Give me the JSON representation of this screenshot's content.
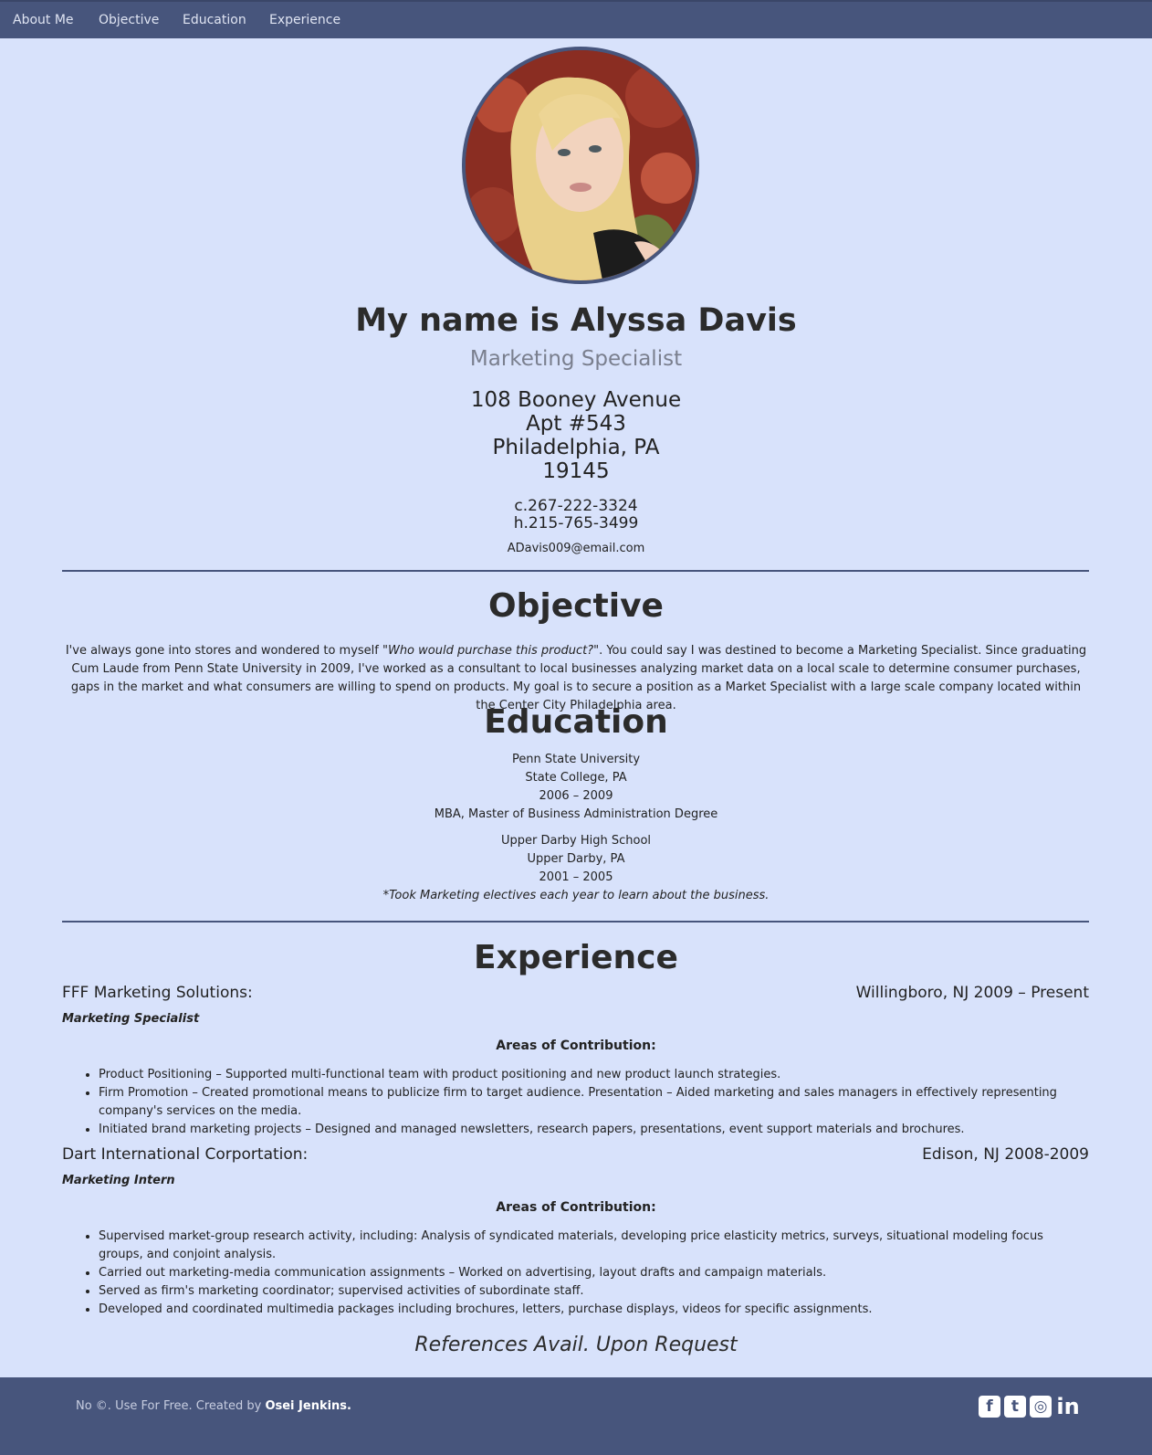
{
  "nav": {
    "items": [
      "About Me",
      "Objective",
      "Education",
      "Experience"
    ]
  },
  "header": {
    "name": "My name is Alyssa Davis",
    "title": "Marketing Specialist",
    "address": [
      "108 Booney Avenue",
      "Apt #543",
      "Philadelphia, PA",
      "19145"
    ],
    "phones": [
      "c.267-222-3324",
      "h.215-765-3499"
    ],
    "email": "ADavis009@email.com"
  },
  "objective": {
    "heading": "Objective",
    "text_before": "I've always gone into stores and wondered to myself ",
    "quote": "\"Who would purchase this product?\"",
    "text_after": ". You could say I was destined to become a Marketing Specialist. Since graduating Cum Laude from Penn State University in 2009, I've worked as a consultant to local businesses analyzing market data on a local scale to determine consumer purchases, gaps in the market and what consumers are willing to spend on products. My goal is to secure a position as a Market Specialist with a large scale company located within the Center City Philadelphia area."
  },
  "education": {
    "heading": "Education",
    "school1": [
      "Penn State University",
      "State College, PA",
      "2006 – 2009",
      "MBA, Master of Business Administration Degree"
    ],
    "school2": [
      "Upper Darby High School",
      "Upper Darby, PA",
      "2001 – 2005"
    ],
    "school2_note": "*Took Marketing electives each year to learn about the business."
  },
  "experience": {
    "heading": "Experience",
    "areas_label": "Areas of Contribution:",
    "jobs": [
      {
        "company": "FFF Marketing Solutions:",
        "location": "Willingboro, NJ 2009 – Present",
        "role": "Marketing Specialist",
        "bullets": [
          "Product Positioning – Supported multi-functional team with product positioning and new product launch strategies.",
          "Firm Promotion – Created promotional means to publicize firm to target audience. Presentation – Aided marketing and sales managers in effectively representing company's services on the media.",
          "Initiated brand marketing projects – Designed and managed newsletters, research papers, presentations, event support materials and brochures."
        ]
      },
      {
        "company": "Dart International Corportation:",
        "location": "Edison, NJ 2008-2009",
        "role": "Marketing Intern",
        "bullets": [
          "Supervised market-group research activity, including: Analysis of syndicated materials, developing price elasticity metrics, surveys, situational modeling focus groups, and conjoint analysis.",
          "Carried out marketing-media communication assignments – Worked on advertising, layout drafts and campaign materials.",
          "Served as firm's marketing coordinator; supervised activities of subordinate staff.",
          "Developed and coordinated multimedia packages including brochures, letters, purchase displays, videos for specific assignments."
        ]
      }
    ]
  },
  "references": "References Avail. Upon Request",
  "footer": {
    "text": "No ©. Use For Free. Created by ",
    "author": "Osei Jenkins.",
    "social_icons": [
      "facebook-icon",
      "twitter-icon",
      "instagram-icon",
      "linkedin-icon"
    ]
  },
  "colors": {
    "background": "#d8e2fb",
    "accent": "#47557c"
  }
}
